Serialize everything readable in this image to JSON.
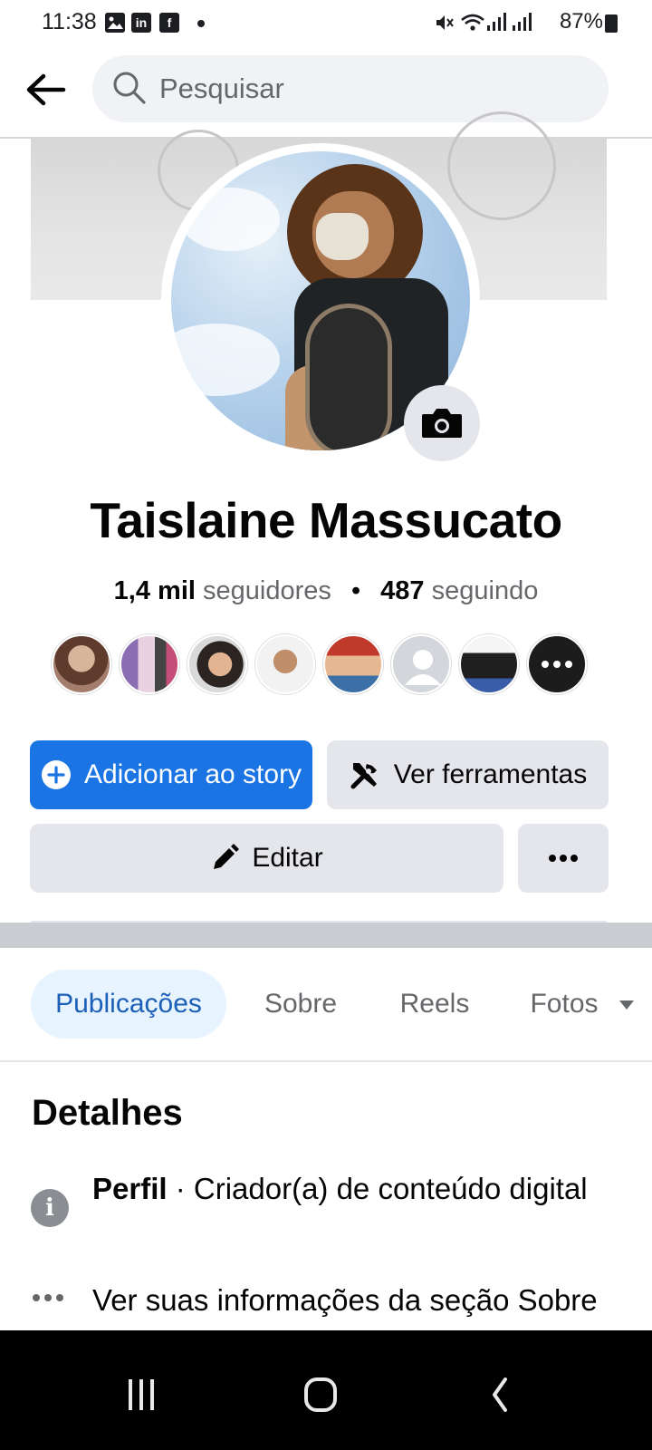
{
  "status_bar": {
    "time": "11:38",
    "battery": "87%",
    "notification_icons": [
      "gallery-icon",
      "linkedin-icon",
      "facebook-icon"
    ],
    "status_icons": [
      "mute-icon",
      "wifi-icon",
      "signal-icon"
    ]
  },
  "search": {
    "placeholder": "Pesquisar"
  },
  "profile": {
    "name": "Taislaine Massucato",
    "followers_count": "1,4 mil",
    "followers_label": "seguidores",
    "separator": "•",
    "following_count": "487",
    "following_label": "seguindo"
  },
  "actions": {
    "add_story_label": "Adicionar ao story",
    "tools_label": "Ver ferramentas",
    "edit_label": "Editar"
  },
  "tabs": [
    {
      "label": "Publicações",
      "active": true
    },
    {
      "label": "Sobre",
      "active": false
    },
    {
      "label": "Reels",
      "active": false
    },
    {
      "label": "Fotos",
      "active": false
    }
  ],
  "details": {
    "title": "Detalhes",
    "profile_label": "Perfil",
    "profile_value": " · Criador(a) de conteúdo digital",
    "about_link": "Ver suas informações da seção Sobre"
  },
  "colors": {
    "accent": "#1b74e4",
    "active_tab_bg": "#e7f3ff",
    "active_tab_text": "#1b5fb6",
    "secondary_button": "#e4e6eb"
  }
}
